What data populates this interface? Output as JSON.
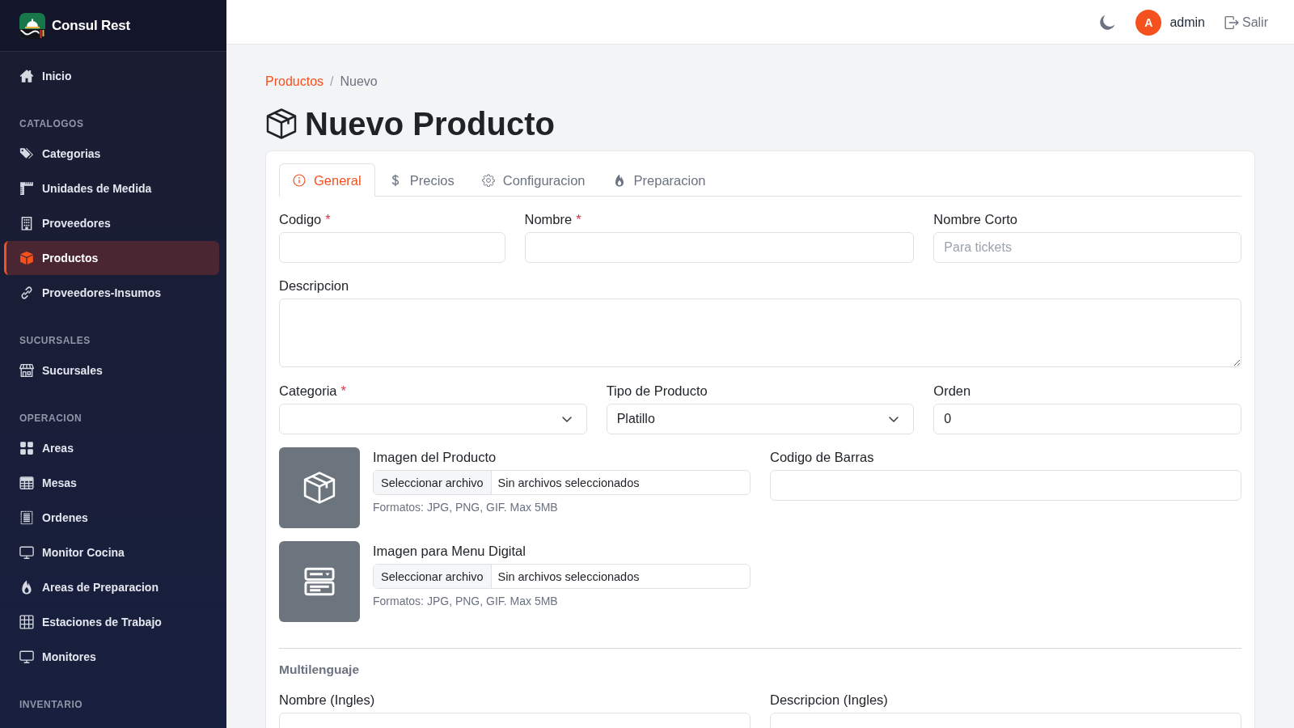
{
  "brand": {
    "name": "Consul Rest"
  },
  "sidebar": {
    "sections": [
      {
        "items": [
          {
            "label": "Inicio",
            "selected": false
          }
        ]
      },
      {
        "heading": "CATALOGOS",
        "items": [
          {
            "label": "Categorias",
            "selected": false
          },
          {
            "label": "Unidades de Medida",
            "selected": false
          },
          {
            "label": "Proveedores",
            "selected": false
          },
          {
            "label": "Productos",
            "selected": true
          },
          {
            "label": "Proveedores-Insumos",
            "selected": false
          }
        ]
      },
      {
        "heading": "SUCURSALES",
        "items": [
          {
            "label": "Sucursales",
            "selected": false
          }
        ]
      },
      {
        "heading": "OPERACION",
        "items": [
          {
            "label": "Areas",
            "selected": false
          },
          {
            "label": "Mesas",
            "selected": false
          },
          {
            "label": "Ordenes",
            "selected": false
          },
          {
            "label": "Monitor Cocina",
            "selected": false
          },
          {
            "label": "Areas de Preparacion",
            "selected": false
          },
          {
            "label": "Estaciones de Trabajo",
            "selected": false
          },
          {
            "label": "Monitores",
            "selected": false
          }
        ]
      },
      {
        "heading": "INVENTARIO"
      }
    ]
  },
  "header": {
    "user": {
      "initial": "A",
      "name": "admin"
    },
    "logout": "Salir"
  },
  "breadcrumb": {
    "separator": "/",
    "items": [
      {
        "label": "Productos",
        "link": true
      },
      {
        "label": "Nuevo",
        "link": false
      }
    ]
  },
  "title": "Nuevo Producto",
  "tabs": [
    {
      "label": "General",
      "selected": true
    },
    {
      "label": "Precios",
      "selected": false
    },
    {
      "label": "Configuracion",
      "selected": false
    },
    {
      "label": "Preparacion",
      "selected": false
    }
  ],
  "form": {
    "basic_fields": [
      {
        "label": "Codigo",
        "required_mark": "*"
      },
      {
        "label": "Nombre",
        "required_mark": "*"
      },
      {
        "label": "Nombre Corto",
        "placeholder": "Para tickets"
      }
    ],
    "description": {
      "label": "Descripcion"
    },
    "classification_fields": [
      {
        "label": "Categoria",
        "required_mark": "*",
        "kind": "select"
      },
      {
        "label": "Tipo de Producto",
        "kind": "select",
        "value": "Platillo"
      },
      {
        "label": "Orden",
        "kind": "input",
        "value": "0"
      }
    ],
    "images": [
      {
        "label": "Imagen del Producto",
        "button": "Seleccionar archivo",
        "status": "Sin archivos seleccionados",
        "hint": "Formatos: JPG, PNG, GIF. Max 5MB"
      },
      {
        "label": "Imagen para Menu Digital",
        "button": "Seleccionar archivo",
        "status": "Sin archivos seleccionados",
        "hint": "Formatos: JPG, PNG, GIF. Max 5MB"
      }
    ],
    "barcode": {
      "label": "Codigo de Barras"
    },
    "multilanguage": {
      "heading": "Multilenguaje",
      "fields": [
        {
          "label": "Nombre (Ingles)"
        },
        {
          "label": "Descripcion (Ingles)"
        }
      ]
    }
  }
}
